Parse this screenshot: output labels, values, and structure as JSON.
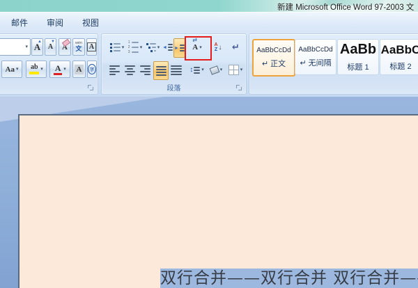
{
  "window": {
    "title": "新建 Microsoft Office Word 97-2003 文"
  },
  "tabs": {
    "mailings": "邮件",
    "review": "审阅",
    "view": "视图"
  },
  "ribbon": {
    "dropdown": "▾",
    "font_group": {
      "grow_font_letter": "A",
      "grow_font_mark": "▲",
      "shrink_font_letter": "A",
      "shrink_font_mark": "▼",
      "clear_format_letter": "A",
      "phonetic_top": "wén",
      "phonetic_bottom": "文",
      "char_border_letter": "A",
      "change_case": "Aa",
      "highlight_letters": "ab",
      "font_color_letter": "A",
      "char_shading_letter": "A",
      "enclose_char": "字"
    },
    "paragraph_group": {
      "label": "段落",
      "asian_layout_letter": "A",
      "asian_layout_arrows": "⇄",
      "sort_a": "A",
      "sort_z": "Z",
      "sort_arrow": "↓",
      "show_hide_mark": "↵",
      "line_spacing_mark": "↕"
    },
    "styles_group": {
      "styles": [
        {
          "preview": "AaBbCcDd",
          "label": "↵ 正文"
        },
        {
          "preview": "AaBbCcDd",
          "label": "↵ 无间隔"
        },
        {
          "preview": "AaBb",
          "label": "标题 1"
        },
        {
          "preview": "AaBbC",
          "label": "标题 2"
        }
      ]
    }
  },
  "document": {
    "selected_text": "双行合并——双行合并 双行合并——双行合"
  },
  "colors": {
    "titlebar_teal": "#8ed5cd",
    "workspace_blue": "#8fb0d9",
    "page_peach": "#fce9d9",
    "selection_blue": "#9cb8de",
    "active_highlight": "#fbd389",
    "annotation_red": "#e51a1a",
    "style_selected_border": "#efa33c"
  }
}
